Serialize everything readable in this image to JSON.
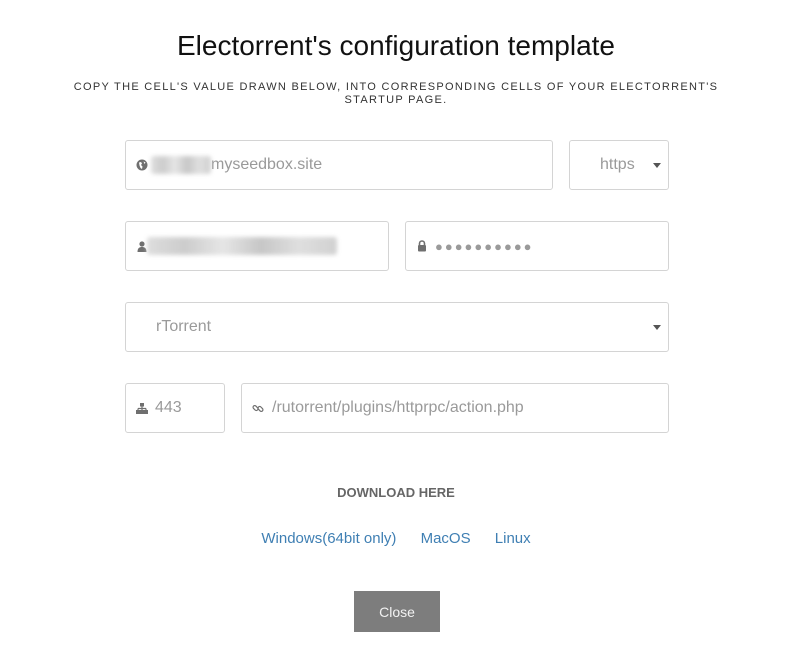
{
  "modal": {
    "title": "Electorrent's configuration template",
    "subtitle": "COPY THE CELL'S VALUE DRAWN BELOW, INTO CORRESPONDING CELLS OF YOUR ELECTORRENT'S STARTUP PAGE."
  },
  "form": {
    "host": {
      "icon": "globe-icon",
      "value_suffix": "myseedbox.site",
      "prefix_redacted": true
    },
    "protocol": {
      "value": "https"
    },
    "username": {
      "icon": "user-icon",
      "redacted": true
    },
    "password": {
      "icon": "lock-icon",
      "masked_value": "●●●●●●●●●●"
    },
    "client": {
      "value": "rTorrent"
    },
    "port": {
      "icon": "sitemap-icon",
      "value": "443"
    },
    "path": {
      "icon": "link-icon",
      "value": "/rutorrent/plugins/httprpc/action.php"
    }
  },
  "download": {
    "heading": "DOWNLOAD HERE",
    "links": [
      {
        "label": "Windows(64bit only)"
      },
      {
        "label": "MacOS"
      },
      {
        "label": "Linux"
      }
    ]
  },
  "close_label": "Close",
  "colors": {
    "link": "#3f7fb3",
    "button_bg": "#7d7d7d",
    "border": "#d4d4d4",
    "placeholder_text": "#9a9a9a"
  }
}
